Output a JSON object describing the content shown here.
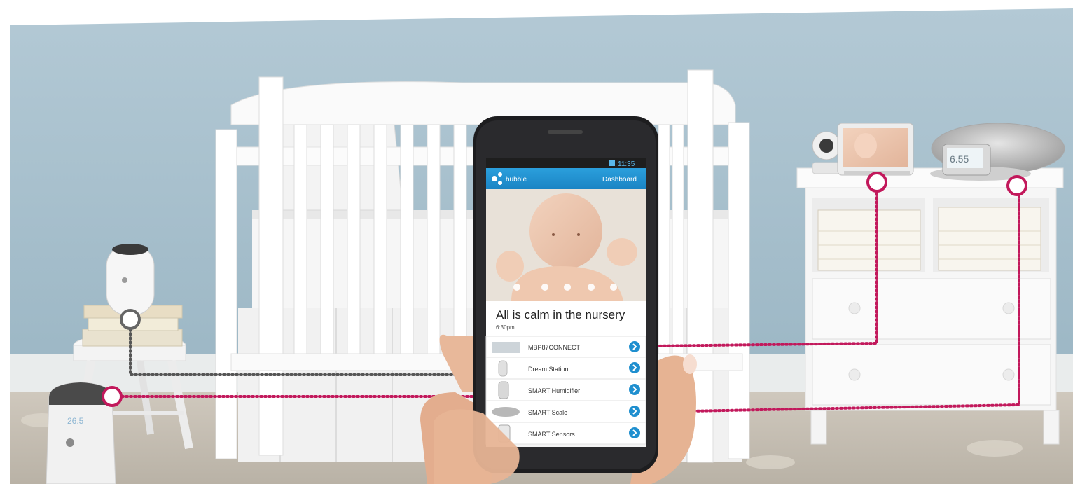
{
  "phone": {
    "status_time": "11:35",
    "app_name": "hubble",
    "header_link": "Dashboard",
    "message": "All is calm in the nursery",
    "time": "6:30pm",
    "devices": [
      {
        "label": "MBP87CONNECT",
        "icon": "camera-icon"
      },
      {
        "label": "Dream Station",
        "icon": "dream-station-icon"
      },
      {
        "label": "SMART Humidifier",
        "icon": "humidifier-icon"
      },
      {
        "label": "SMART Scale",
        "icon": "scale-icon"
      },
      {
        "label": "SMART Sensors",
        "icon": "sensors-icon"
      }
    ]
  },
  "scale_display": "6.55",
  "humidifier_display": "26.5",
  "colors": {
    "wall": "#a9c3d0",
    "accent_blue": "#1f8fcf",
    "connector_pink": "#c2185b",
    "connector_gray": "#555555"
  }
}
